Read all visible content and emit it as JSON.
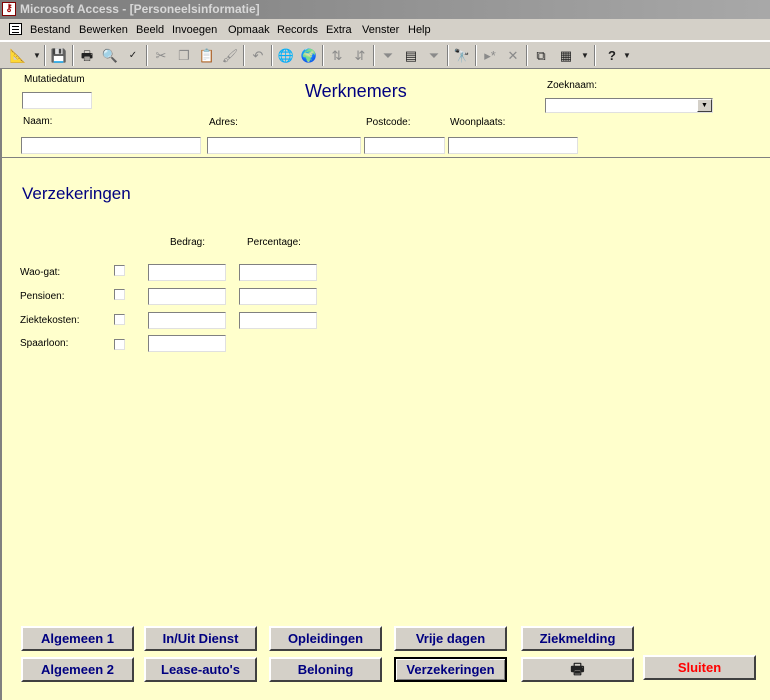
{
  "window": {
    "title": "Microsoft Access - [Personeelsinformatie]"
  },
  "menu": [
    "Bestand",
    "Bewerken",
    "Beeld",
    "Invoegen",
    "Opmaak",
    "Records",
    "Extra",
    "Venster",
    "Help"
  ],
  "toolbar": {
    "icons": [
      "design-view-icon",
      "save-icon",
      "print-icon",
      "print-preview-icon",
      "spelling-icon",
      "cut-icon",
      "copy-icon",
      "paste-icon",
      "format-painter-icon",
      "undo-icon",
      "hyperlink-icon",
      "web-toolbar-icon",
      "sort-ascending-icon",
      "sort-descending-icon",
      "filter-by-selection-icon",
      "filter-by-form-icon",
      "apply-filter-icon",
      "find-icon",
      "new-record-icon",
      "delete-record-icon",
      "database-window-icon",
      "new-object-icon",
      "help-icon"
    ]
  },
  "header": {
    "mutatiedatum_label": "Mutatiedatum",
    "title": "Werknemers",
    "zoeknaam_label": "Zoeknaam:",
    "naam_label": "Naam:",
    "adres_label": "Adres:",
    "postcode_label": "Postcode:",
    "woonplaats_label": "Woonplaats:"
  },
  "section": {
    "title": "Verzekeringen",
    "bedrag_label": "Bedrag:",
    "percentage_label": "Percentage:",
    "rows": [
      {
        "label": "Wao-gat:"
      },
      {
        "label": "Pensioen:"
      },
      {
        "label": "Ziektekosten:"
      },
      {
        "label": "Spaarloon:"
      }
    ]
  },
  "buttons": {
    "algemeen1": "Algemeen 1",
    "inuit": "In/Uit Dienst",
    "opleidingen": "Opleidingen",
    "vrije": "Vrije dagen",
    "ziekmelding": "Ziekmelding",
    "algemeen2": "Algemeen 2",
    "lease": "Lease-auto's",
    "beloning": "Beloning",
    "verzekeringen": "Verzekeringen",
    "sluiten": "Sluiten"
  },
  "colors": {
    "form_background": "#ffffcc",
    "heading": "#000080",
    "close_button_text": "#ff0000"
  }
}
